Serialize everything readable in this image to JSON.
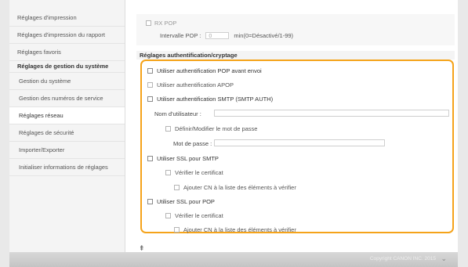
{
  "sidebar": {
    "items": [
      {
        "label": "Réglages d'impression"
      },
      {
        "label": "Réglages d'impression du rapport"
      },
      {
        "label": "Réglages favoris"
      },
      {
        "label": "Réglages de gestion du système"
      },
      {
        "label": "Gestion du système"
      },
      {
        "label": "Gestion des numéros de service"
      },
      {
        "label": "Réglages réseau"
      },
      {
        "label": "Réglages de sécurité"
      },
      {
        "label": "Importer/Exporter"
      },
      {
        "label": "Initialiser informations de réglages"
      }
    ]
  },
  "rx_pop": {
    "label": "RX POP",
    "interval_label": "Intervalle POP :",
    "interval_value": "0",
    "interval_unit": "min(0=Désactivé/1-99)"
  },
  "auth": {
    "header": "Réglages authentification/cryptage",
    "pop_before_send": "Utiliser authentification POP avant envoi",
    "apop": "Utiliser authentification APOP",
    "smtp_auth": "Utiliser authentification SMTP (SMTP AUTH)",
    "username_label": "Nom d'utilisateur :",
    "set_password": "Définir/Modifier le mot de passe",
    "password_label": "Mot de passe :",
    "ssl_smtp": "Utiliser SSL pour SMTP",
    "verify_cert_smtp": "Vérifier le certificat",
    "add_cn_smtp": "Ajouter CN à la liste des éléments à vérifier",
    "ssl_pop": "Utiliser SSL pour POP",
    "verify_cert_pop": "Vérifier le certificat",
    "add_cn_pop": "Ajouter CN à la liste des éléments à vérifier"
  },
  "footer": {
    "copyright": "Copyright CANON INC. 2015"
  },
  "icons": {
    "top": "to-top-icon",
    "scroll": "scroll-down-icon"
  }
}
